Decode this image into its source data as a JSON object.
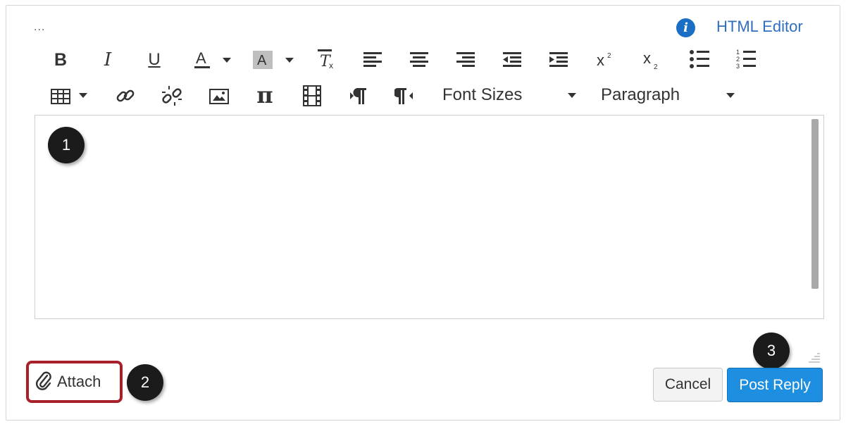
{
  "header": {
    "ellipsis": "...",
    "html_editor_label": "HTML Editor",
    "info_icon_glyph": "i"
  },
  "toolbar": {
    "row1": [
      "bold-icon",
      "italic-icon",
      "underline-icon",
      "text-color-icon",
      "background-color-icon",
      "clear-formatting-icon",
      "align-left-icon",
      "align-center-icon",
      "align-right-icon",
      "outdent-icon",
      "indent-icon",
      "superscript-icon",
      "subscript-icon",
      "bullet-list-icon",
      "numbered-list-icon"
    ],
    "row2": [
      "table-icon",
      "link-icon",
      "unlink-icon",
      "image-icon",
      "equation-icon",
      "media-icon",
      "ltr-icon",
      "rtl-icon"
    ],
    "font_sizes_label": "Font Sizes",
    "paragraph_label": "Paragraph"
  },
  "editor": {
    "content": ""
  },
  "callouts": {
    "one": "1",
    "two": "2",
    "three": "3"
  },
  "footer": {
    "attach_label": "Attach",
    "cancel_label": "Cancel",
    "post_reply_label": "Post Reply"
  },
  "colors": {
    "accent": "#1d8ee0",
    "highlight_border": "#a8202a",
    "link": "#2f6fc1"
  }
}
